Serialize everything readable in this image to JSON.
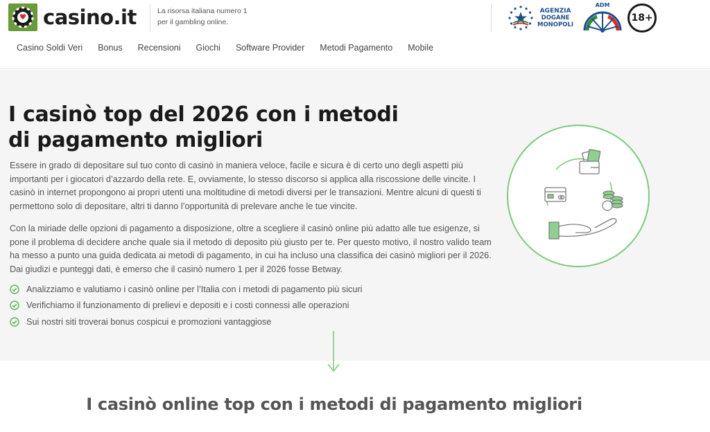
{
  "header": {
    "logo_text": "casino.it",
    "tagline_line1": "La risorsa italiana numero 1",
    "tagline_line2": "per il gambling online.",
    "agency_line1": "AGENZIA",
    "agency_line2": "DOGANE",
    "agency_line3": "MONOPOLI",
    "adm_label": "ADM",
    "age_badge": "18+"
  },
  "nav": {
    "items": [
      {
        "label": "Casino Soldi Veri"
      },
      {
        "label": "Bonus"
      },
      {
        "label": "Recensioni"
      },
      {
        "label": "Giochi"
      },
      {
        "label": "Software Provider"
      },
      {
        "label": "Metodi Pagamento"
      },
      {
        "label": "Mobile"
      }
    ]
  },
  "hero": {
    "title": "I casinò top del 2026 con i metodi di pagamento migliori",
    "paragraph1": "Essere in grado di depositare sul tuo conto di casinò in maniera veloce, facile e sicura è di certo uno degli aspetti più importanti per i giocatori d’azzardo della rete. E, ovviamente, lo stesso discorso si applica alla riscossione delle vincite. I casinò in internet propongono ai propri utenti una moltitudine di metodi diversi per le transazioni. Mentre alcuni di questi ti permettono solo di depositare, altri ti danno l’opportunità di prelevare anche le tue vincite.",
    "paragraph2": "Con la miriade delle opzioni di pagamento a disposizione, oltre a scegliere il casinò online più adatto alle tue esigenze, si pone il problema di decidere anche quale sia il metodo di deposito più giusto per te. Per questo motivo, il nostro valido team ha messo a punto una guida dedicata ai metodi di pagamento, in cui ha incluso una classifica dei casinò migliori per il 2026. Dai giudizi e punteggi dati, è emerso che il casinò numero 1 per il 2026 fosse Betway.",
    "checks": [
      {
        "text": "Analizziamo e valutiamo i casinò online per l’Italia con i metodi di pagamento più sicuri"
      },
      {
        "text": "Verifichiamo il funzionamento di prelievi e depositi e i costi connessi alle operazioni"
      },
      {
        "text": "Sui nostri siti troverai bonus cospicui e promozioni vantaggiose"
      }
    ],
    "illustration_icon": "payment-cycle-icon"
  },
  "section": {
    "title": "I casinò online top con i metodi di pagamento migliori"
  },
  "colors": {
    "accent_green": "#5cb85c",
    "logo_green": "#6a9a3a",
    "adm_blue": "#1f4e8c"
  }
}
